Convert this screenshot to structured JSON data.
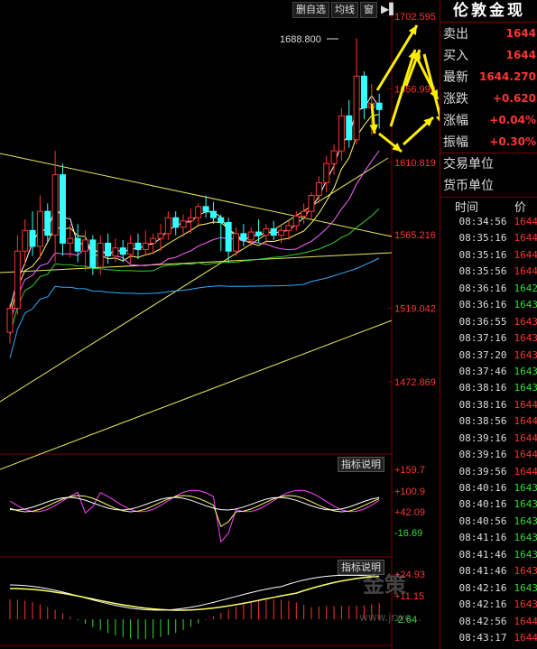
{
  "toolbar": {
    "delete_label": "删自选",
    "ma_label": "均线",
    "window_label": "窗"
  },
  "panel": {
    "title": "伦敦金现",
    "quotes": [
      {
        "label": "卖出",
        "value": "1644"
      },
      {
        "label": "买入",
        "value": "1644"
      },
      {
        "label": "最新",
        "value": "1644.270"
      },
      {
        "label": "涨跌",
        "value": "+0.620"
      },
      {
        "label": "涨幅",
        "value": "+0.04%"
      },
      {
        "label": "振幅",
        "value": "+0.30%"
      }
    ],
    "unit_rows": [
      "交易单位",
      "货币单位"
    ],
    "ticks_header": {
      "time": "时间",
      "price": "价"
    },
    "ticks": [
      {
        "t": "08:34:56",
        "p": "1644",
        "up": true
      },
      {
        "t": "08:35:16",
        "p": "1644",
        "up": true
      },
      {
        "t": "08:35:16",
        "p": "1644",
        "up": true
      },
      {
        "t": "08:35:56",
        "p": "1644",
        "up": true
      },
      {
        "t": "08:36:16",
        "p": "1642",
        "up": false
      },
      {
        "t": "08:36:16",
        "p": "1643",
        "up": false
      },
      {
        "t": "08:36:55",
        "p": "1643",
        "up": true
      },
      {
        "t": "08:37:16",
        "p": "1643",
        "up": true
      },
      {
        "t": "08:37:20",
        "p": "1643",
        "up": true
      },
      {
        "t": "08:37:46",
        "p": "1643",
        "up": false
      },
      {
        "t": "08:38:16",
        "p": "1643",
        "up": false
      },
      {
        "t": "08:38:16",
        "p": "1644",
        "up": true
      },
      {
        "t": "08:38:56",
        "p": "1644",
        "up": true
      },
      {
        "t": "08:39:16",
        "p": "1644",
        "up": true
      },
      {
        "t": "08:39:16",
        "p": "1644",
        "up": true
      },
      {
        "t": "08:39:56",
        "p": "1644",
        "up": true
      },
      {
        "t": "08:40:16",
        "p": "1643",
        "up": false
      },
      {
        "t": "08:40:16",
        "p": "1643",
        "up": false
      },
      {
        "t": "08:40:56",
        "p": "1643",
        "up": false
      },
      {
        "t": "08:41:16",
        "p": "1643",
        "up": false
      },
      {
        "t": "08:41:46",
        "p": "1643",
        "up": false
      },
      {
        "t": "08:41:46",
        "p": "1643",
        "up": true
      },
      {
        "t": "08:42:16",
        "p": "1643",
        "up": false
      },
      {
        "t": "08:42:16",
        "p": "1643",
        "up": true
      },
      {
        "t": "08:42:56",
        "p": "1644",
        "up": true
      },
      {
        "t": "08:43:17",
        "p": "1644",
        "up": true
      }
    ]
  },
  "indicator_buttons": {
    "top": "指标说明",
    "bottom": "指标说明"
  },
  "watermark": {
    "logo": "金策",
    "url": "www.jrwe..."
  },
  "chart_data": {
    "type": "candlestick",
    "price_axis": {
      "ticks": [
        "1702.595",
        "1656.993",
        "1610.819",
        "1565.216",
        "1519.042",
        "1472.869"
      ]
    },
    "annotation": "1688.800",
    "candles": [
      {
        "o": 1504,
        "h": 1522,
        "l": 1497,
        "c": 1519
      },
      {
        "o": 1519,
        "h": 1565,
        "l": 1515,
        "c": 1555
      },
      {
        "o": 1555,
        "h": 1575,
        "l": 1546,
        "c": 1568
      },
      {
        "o": 1568,
        "h": 1580,
        "l": 1552,
        "c": 1558
      },
      {
        "o": 1558,
        "h": 1590,
        "l": 1550,
        "c": 1580
      },
      {
        "o": 1580,
        "h": 1585,
        "l": 1560,
        "c": 1565
      },
      {
        "o": 1565,
        "h": 1618,
        "l": 1548,
        "c": 1603
      },
      {
        "o": 1603,
        "h": 1610,
        "l": 1552,
        "c": 1560
      },
      {
        "o": 1560,
        "h": 1572,
        "l": 1551,
        "c": 1563
      },
      {
        "o": 1563,
        "h": 1572,
        "l": 1548,
        "c": 1555
      },
      {
        "o": 1555,
        "h": 1568,
        "l": 1543,
        "c": 1562
      },
      {
        "o": 1562,
        "h": 1565,
        "l": 1540,
        "c": 1545
      },
      {
        "o": 1545,
        "h": 1565,
        "l": 1540,
        "c": 1560
      },
      {
        "o": 1560,
        "h": 1566,
        "l": 1547,
        "c": 1552
      },
      {
        "o": 1552,
        "h": 1563,
        "l": 1548,
        "c": 1557
      },
      {
        "o": 1557,
        "h": 1562,
        "l": 1548,
        "c": 1553
      },
      {
        "o": 1553,
        "h": 1565,
        "l": 1547,
        "c": 1560
      },
      {
        "o": 1560,
        "h": 1566,
        "l": 1550,
        "c": 1556
      },
      {
        "o": 1556,
        "h": 1568,
        "l": 1552,
        "c": 1560
      },
      {
        "o": 1560,
        "h": 1566,
        "l": 1553,
        "c": 1563
      },
      {
        "o": 1563,
        "h": 1572,
        "l": 1555,
        "c": 1566
      },
      {
        "o": 1566,
        "h": 1580,
        "l": 1562,
        "c": 1576
      },
      {
        "o": 1576,
        "h": 1580,
        "l": 1565,
        "c": 1570
      },
      {
        "o": 1570,
        "h": 1578,
        "l": 1564,
        "c": 1574
      },
      {
        "o": 1574,
        "h": 1582,
        "l": 1566,
        "c": 1576
      },
      {
        "o": 1576,
        "h": 1585,
        "l": 1570,
        "c": 1583
      },
      {
        "o": 1583,
        "h": 1590,
        "l": 1576,
        "c": 1580
      },
      {
        "o": 1580,
        "h": 1586,
        "l": 1572,
        "c": 1576
      },
      {
        "o": 1576,
        "h": 1578,
        "l": 1555,
        "c": 1573
      },
      {
        "o": 1573,
        "h": 1576,
        "l": 1548,
        "c": 1555
      },
      {
        "o": 1555,
        "h": 1570,
        "l": 1552,
        "c": 1566
      },
      {
        "o": 1566,
        "h": 1572,
        "l": 1558,
        "c": 1562
      },
      {
        "o": 1562,
        "h": 1570,
        "l": 1558,
        "c": 1567
      },
      {
        "o": 1567,
        "h": 1575,
        "l": 1560,
        "c": 1565
      },
      {
        "o": 1565,
        "h": 1572,
        "l": 1560,
        "c": 1569
      },
      {
        "o": 1569,
        "h": 1574,
        "l": 1562,
        "c": 1565
      },
      {
        "o": 1565,
        "h": 1572,
        "l": 1560,
        "c": 1568
      },
      {
        "o": 1568,
        "h": 1574,
        "l": 1562,
        "c": 1571
      },
      {
        "o": 1571,
        "h": 1580,
        "l": 1568,
        "c": 1577
      },
      {
        "o": 1577,
        "h": 1585,
        "l": 1572,
        "c": 1580
      },
      {
        "o": 1580,
        "h": 1592,
        "l": 1575,
        "c": 1590
      },
      {
        "o": 1590,
        "h": 1602,
        "l": 1585,
        "c": 1598
      },
      {
        "o": 1598,
        "h": 1615,
        "l": 1592,
        "c": 1610
      },
      {
        "o": 1610,
        "h": 1622,
        "l": 1603,
        "c": 1618
      },
      {
        "o": 1618,
        "h": 1645,
        "l": 1612,
        "c": 1640
      },
      {
        "o": 1640,
        "h": 1650,
        "l": 1620,
        "c": 1625
      },
      {
        "o": 1625,
        "h": 1688.8,
        "l": 1622,
        "c": 1665
      },
      {
        "o": 1665,
        "h": 1668,
        "l": 1638,
        "c": 1645
      },
      {
        "o": 1645,
        "h": 1660,
        "l": 1628,
        "c": 1648
      },
      {
        "o": 1648,
        "h": 1654,
        "l": 1632,
        "c": 1644
      }
    ],
    "ma_colors": [
      "#ffffff",
      "#ffff66",
      "#ff66ff",
      "#33cc33",
      "#33aaff"
    ],
    "indicator1": {
      "ticks": [
        "+159.7",
        "+100.9",
        "+42.09",
        "-16.69"
      ]
    },
    "indicator2": {
      "ticks": [
        "+24.93",
        "+11.15",
        "-2.64"
      ]
    }
  }
}
